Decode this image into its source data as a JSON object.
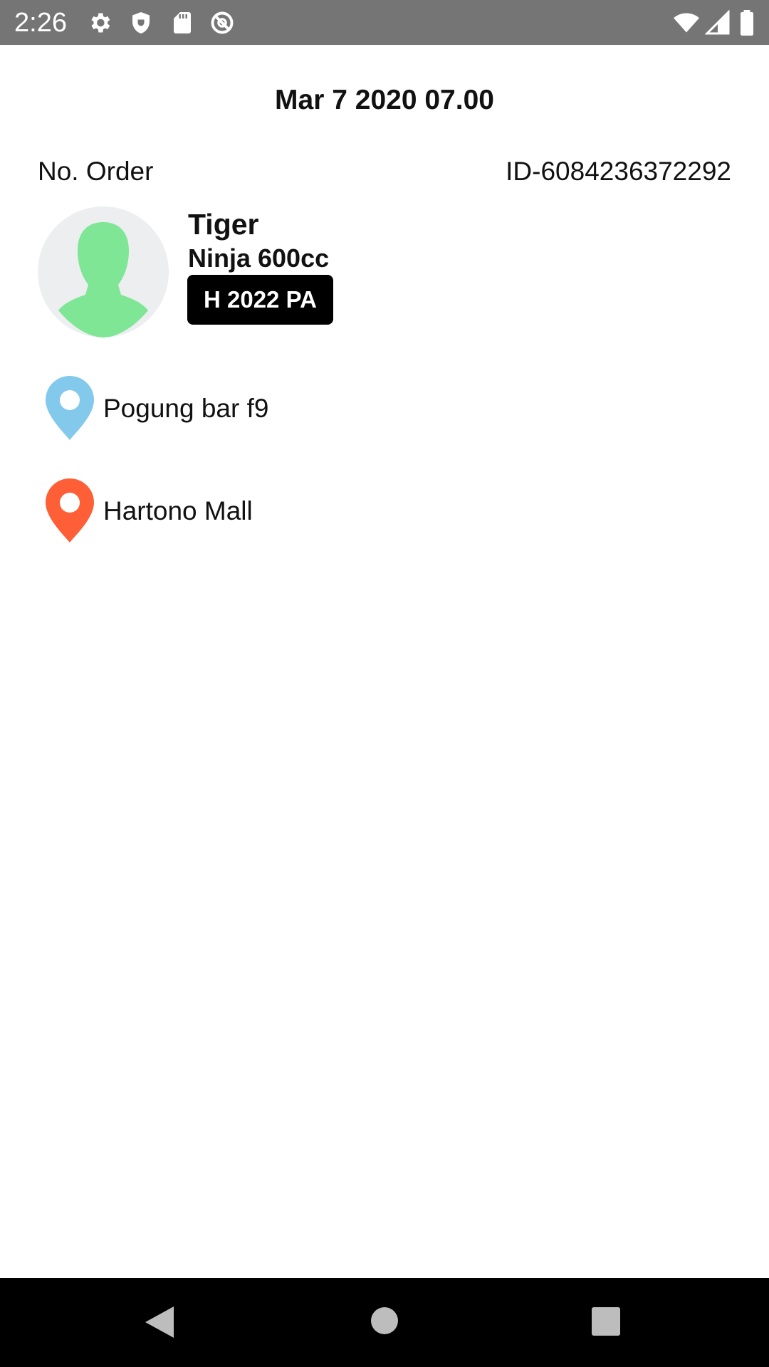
{
  "status_bar": {
    "time": "2:26",
    "left_icons": [
      "gear-icon",
      "shield-icon",
      "sd-card-icon",
      "do-not-disturb-icon"
    ],
    "right_icons": [
      "wifi-icon",
      "signal-icon",
      "battery-icon"
    ],
    "background_color": "#757575"
  },
  "order": {
    "date": "Mar 7 2020 07.00",
    "number_label": "No. Order",
    "id": "ID-6084236372292"
  },
  "driver": {
    "name": "Tiger",
    "vehicle": "Ninja 600cc",
    "plate": "H 2022 PA",
    "avatar_icon": "person-avatar-icon",
    "avatar_color": "#7ee694"
  },
  "route": {
    "pickup": {
      "label": "Pogung bar f9",
      "icon": "location-pin-icon",
      "color": "#83c9ec"
    },
    "destination": {
      "label": "Hartono Mall",
      "icon": "location-pin-icon",
      "color": "#ff5f36"
    }
  },
  "nav_bar": {
    "buttons": [
      "back-icon",
      "home-icon",
      "recents-icon"
    ]
  }
}
